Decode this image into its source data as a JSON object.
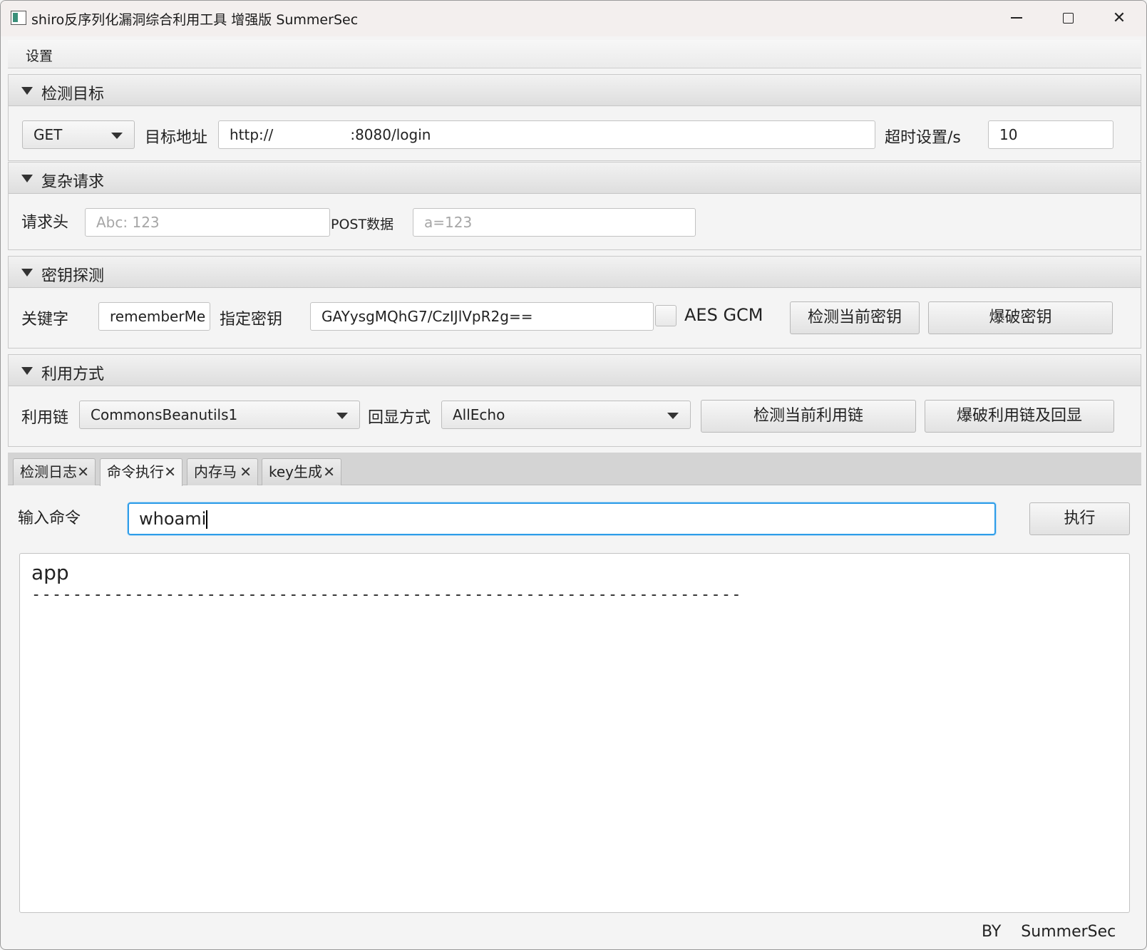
{
  "window": {
    "title": "shiro反序列化漏洞综合利用工具 增强版 SummerSec",
    "minimize_label": "",
    "maximize_label": "",
    "close_label": "✕"
  },
  "menubar": {
    "settings": "设置"
  },
  "target_pane": {
    "title": "检测目标",
    "method": "GET",
    "url_label": "目标地址",
    "url_value": "http://                 :8080/login",
    "timeout_label": "超时设置/s",
    "timeout_value": "10"
  },
  "complex_pane": {
    "title": "复杂请求",
    "header_label": "请求头",
    "header_placeholder": "Abc: 123",
    "post_label": "POST数据",
    "post_placeholder": "a=123"
  },
  "key_pane": {
    "title": "密钥探测",
    "keyword_label": "关键字",
    "keyword_value": "rememberMe",
    "key_label": "指定密钥",
    "key_value": "GAYysgMQhG7/CzIJlVpR2g==",
    "aes_gcm_label": "AES GCM",
    "aes_gcm_checked": false,
    "check_key_button": "检测当前密钥",
    "brute_key_button": "爆破密钥"
  },
  "exploit_pane": {
    "title": "利用方式",
    "chain_label": "利用链",
    "chain_value": "CommonsBeanutils1",
    "echo_label": "回显方式",
    "echo_value": "AllEcho",
    "check_chain_button": "检测当前利用链",
    "brute_chain_button": "爆破利用链及回显"
  },
  "tabs": [
    {
      "label": "检测日志",
      "close": "✕",
      "active": false
    },
    {
      "label": "命令执行",
      "close": "✕",
      "active": true
    },
    {
      "label": "内存马",
      "close": "✕",
      "active": false
    },
    {
      "label": "key生成",
      "close": "✕",
      "active": false
    }
  ],
  "command": {
    "label": "输入命令",
    "value": "whoami",
    "execute_button": "执行"
  },
  "output": {
    "line1": "app",
    "line2": "---------------------------------------------------------------------"
  },
  "footer": {
    "text": "BY    SummerSec"
  },
  "colors": {
    "focus_border": "#2e9de8",
    "background": "#f4f4f4"
  }
}
